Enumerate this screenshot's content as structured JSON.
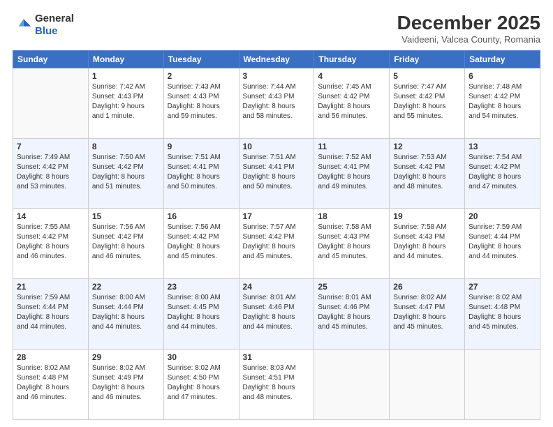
{
  "logo": {
    "general": "General",
    "blue": "Blue"
  },
  "header": {
    "month": "December 2025",
    "location": "Vaideeni, Valcea County, Romania"
  },
  "days_of_week": [
    "Sunday",
    "Monday",
    "Tuesday",
    "Wednesday",
    "Thursday",
    "Friday",
    "Saturday"
  ],
  "weeks": [
    [
      {
        "day": "",
        "info": ""
      },
      {
        "day": "1",
        "info": "Sunrise: 7:42 AM\nSunset: 4:43 PM\nDaylight: 9 hours\nand 1 minute."
      },
      {
        "day": "2",
        "info": "Sunrise: 7:43 AM\nSunset: 4:43 PM\nDaylight: 8 hours\nand 59 minutes."
      },
      {
        "day": "3",
        "info": "Sunrise: 7:44 AM\nSunset: 4:43 PM\nDaylight: 8 hours\nand 58 minutes."
      },
      {
        "day": "4",
        "info": "Sunrise: 7:45 AM\nSunset: 4:42 PM\nDaylight: 8 hours\nand 56 minutes."
      },
      {
        "day": "5",
        "info": "Sunrise: 7:47 AM\nSunset: 4:42 PM\nDaylight: 8 hours\nand 55 minutes."
      },
      {
        "day": "6",
        "info": "Sunrise: 7:48 AM\nSunset: 4:42 PM\nDaylight: 8 hours\nand 54 minutes."
      }
    ],
    [
      {
        "day": "7",
        "info": "Sunrise: 7:49 AM\nSunset: 4:42 PM\nDaylight: 8 hours\nand 53 minutes."
      },
      {
        "day": "8",
        "info": "Sunrise: 7:50 AM\nSunset: 4:42 PM\nDaylight: 8 hours\nand 51 minutes."
      },
      {
        "day": "9",
        "info": "Sunrise: 7:51 AM\nSunset: 4:41 PM\nDaylight: 8 hours\nand 50 minutes."
      },
      {
        "day": "10",
        "info": "Sunrise: 7:51 AM\nSunset: 4:41 PM\nDaylight: 8 hours\nand 50 minutes."
      },
      {
        "day": "11",
        "info": "Sunrise: 7:52 AM\nSunset: 4:41 PM\nDaylight: 8 hours\nand 49 minutes."
      },
      {
        "day": "12",
        "info": "Sunrise: 7:53 AM\nSunset: 4:42 PM\nDaylight: 8 hours\nand 48 minutes."
      },
      {
        "day": "13",
        "info": "Sunrise: 7:54 AM\nSunset: 4:42 PM\nDaylight: 8 hours\nand 47 minutes."
      }
    ],
    [
      {
        "day": "14",
        "info": "Sunrise: 7:55 AM\nSunset: 4:42 PM\nDaylight: 8 hours\nand 46 minutes."
      },
      {
        "day": "15",
        "info": "Sunrise: 7:56 AM\nSunset: 4:42 PM\nDaylight: 8 hours\nand 46 minutes."
      },
      {
        "day": "16",
        "info": "Sunrise: 7:56 AM\nSunset: 4:42 PM\nDaylight: 8 hours\nand 45 minutes."
      },
      {
        "day": "17",
        "info": "Sunrise: 7:57 AM\nSunset: 4:42 PM\nDaylight: 8 hours\nand 45 minutes."
      },
      {
        "day": "18",
        "info": "Sunrise: 7:58 AM\nSunset: 4:43 PM\nDaylight: 8 hours\nand 45 minutes."
      },
      {
        "day": "19",
        "info": "Sunrise: 7:58 AM\nSunset: 4:43 PM\nDaylight: 8 hours\nand 44 minutes."
      },
      {
        "day": "20",
        "info": "Sunrise: 7:59 AM\nSunset: 4:44 PM\nDaylight: 8 hours\nand 44 minutes."
      }
    ],
    [
      {
        "day": "21",
        "info": "Sunrise: 7:59 AM\nSunset: 4:44 PM\nDaylight: 8 hours\nand 44 minutes."
      },
      {
        "day": "22",
        "info": "Sunrise: 8:00 AM\nSunset: 4:44 PM\nDaylight: 8 hours\nand 44 minutes."
      },
      {
        "day": "23",
        "info": "Sunrise: 8:00 AM\nSunset: 4:45 PM\nDaylight: 8 hours\nand 44 minutes."
      },
      {
        "day": "24",
        "info": "Sunrise: 8:01 AM\nSunset: 4:46 PM\nDaylight: 8 hours\nand 44 minutes."
      },
      {
        "day": "25",
        "info": "Sunrise: 8:01 AM\nSunset: 4:46 PM\nDaylight: 8 hours\nand 45 minutes."
      },
      {
        "day": "26",
        "info": "Sunrise: 8:02 AM\nSunset: 4:47 PM\nDaylight: 8 hours\nand 45 minutes."
      },
      {
        "day": "27",
        "info": "Sunrise: 8:02 AM\nSunset: 4:48 PM\nDaylight: 8 hours\nand 45 minutes."
      }
    ],
    [
      {
        "day": "28",
        "info": "Sunrise: 8:02 AM\nSunset: 4:48 PM\nDaylight: 8 hours\nand 46 minutes."
      },
      {
        "day": "29",
        "info": "Sunrise: 8:02 AM\nSunset: 4:49 PM\nDaylight: 8 hours\nand 46 minutes."
      },
      {
        "day": "30",
        "info": "Sunrise: 8:02 AM\nSunset: 4:50 PM\nDaylight: 8 hours\nand 47 minutes."
      },
      {
        "day": "31",
        "info": "Sunrise: 8:03 AM\nSunset: 4:51 PM\nDaylight: 8 hours\nand 48 minutes."
      },
      {
        "day": "",
        "info": ""
      },
      {
        "day": "",
        "info": ""
      },
      {
        "day": "",
        "info": ""
      }
    ]
  ]
}
